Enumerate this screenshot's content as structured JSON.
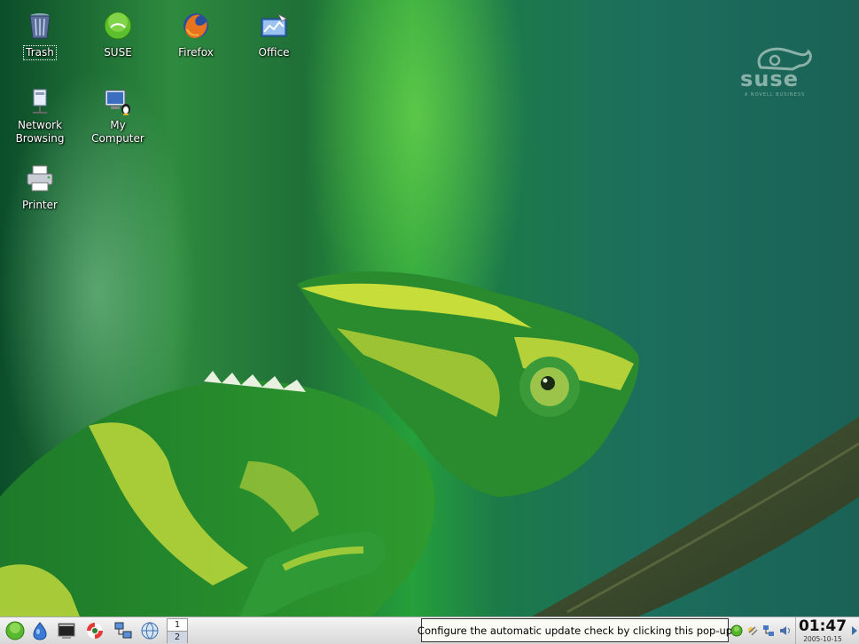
{
  "desktop": {
    "icons": [
      {
        "label": "Trash",
        "icon": "trash-icon"
      },
      {
        "label": "SUSE",
        "icon": "suse-icon"
      },
      {
        "label": "Firefox",
        "icon": "firefox-icon"
      },
      {
        "label": "Office",
        "icon": "office-icon"
      },
      {
        "label": "Network\nBrowsing",
        "icon": "network-icon"
      },
      {
        "label": "My\nComputer",
        "icon": "computer-icon"
      },
      {
        "label": "Printer",
        "icon": "printer-icon"
      }
    ],
    "watermark_text": "suse",
    "watermark_subtext": "A NOVELL BUSINESS"
  },
  "panel": {
    "launchers": [
      "kmenu-icon",
      "suse-drop-icon",
      "terminal-icon",
      "help-lifebuoy-icon",
      "network-icon",
      "browser-icon"
    ],
    "pager": [
      "1",
      "2"
    ],
    "tooltip": "Configure the automatic update check by clicking this pop-up",
    "tray_icons": [
      "update-icon",
      "kopete-icon",
      "network-tray-icon",
      "volume-icon"
    ],
    "clock_time": "01:47",
    "clock_date": "2005-10-15"
  },
  "colors": {
    "wallpaper_green": "#1f7a3a",
    "panel_bg": "#e2e2e2",
    "tooltip_bg": "#fbfbf6"
  }
}
